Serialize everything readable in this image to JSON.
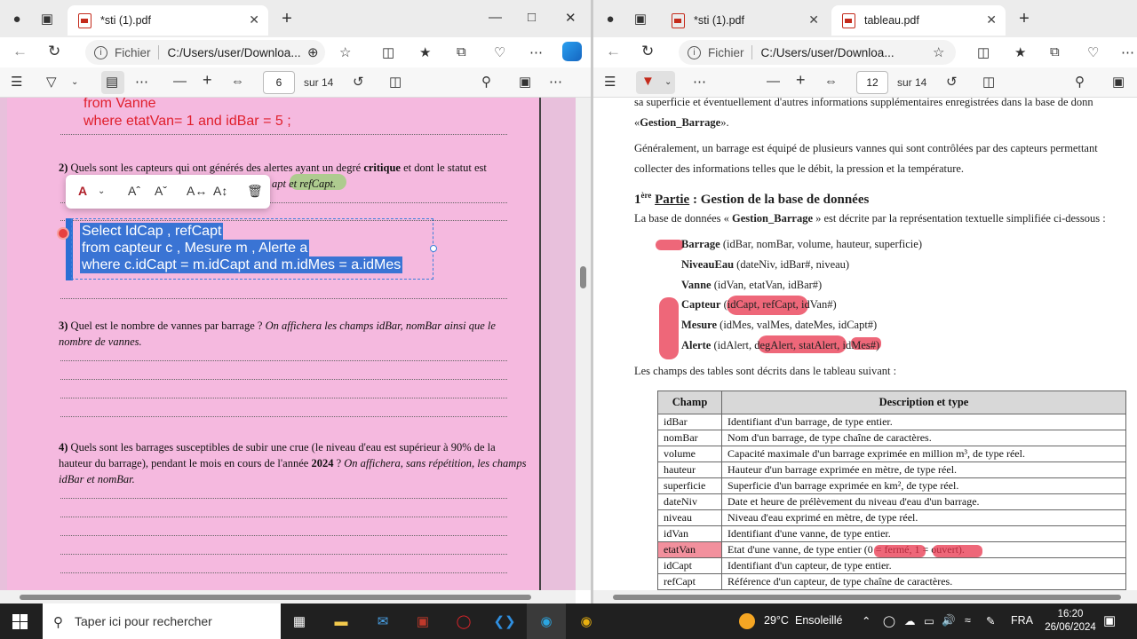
{
  "left_window": {
    "tab_title": "*sti (1).pdf",
    "url_label": "Fichier",
    "url": "C:/Users/user/Downloa...",
    "page_current": "6",
    "page_total": "sur 14",
    "document": {
      "sql_prev_line1": "from Vanne",
      "sql_prev_line2": "where etatVan= 1 and idBar = 5 ;",
      "q2_num": "2)",
      "q2_text": "Quels sont les capteurs qui ont générés des alertes ayant un degré",
      "q2_bold": "critique",
      "q2_text2": "et dont le statut est",
      "q2_partial": "apt et refCapt.",
      "sql_selected": [
        "Select IdCap , refCapt",
        "from capteur c , Mesure m , Alerte a",
        "where c.idCapt = m.idCapt and m.idMes = a.idMes"
      ],
      "q3_num": "3)",
      "q3_text": "Quel est le nombre de vannes par barrage ?",
      "q3_italic": "On affichera les champs idBar, nomBar ainsi que le nombre de vannes.",
      "q4_num": "4)",
      "q4_text1": "Quels sont les barrages susceptibles de subir une crue (le niveau d'eau est supérieur à 90% de la",
      "q4_text2": "hauteur du barrage), pendant le mois en cours de l'année",
      "q4_year": "2024",
      "q4_italic": "On affichera, sans répétition,",
      "q4_italic2": "les champs idBar et nomBar."
    }
  },
  "right_window": {
    "tab1_title": "*sti (1).pdf",
    "tab2_title": "tableau.pdf",
    "url_label": "Fichier",
    "url": "C:/Users/user/Downloa...",
    "page_current": "12",
    "page_total": "sur 14",
    "document": {
      "line_top": "sa superficie et éventuellement d'autres informations supplémentaires enregistrées dans la base de donn",
      "line_top2_pre": "«",
      "line_top2_bold": "Gestion_Barrage",
      "line_top2_post": "».",
      "para1": "Généralement, un barrage est équipé de plusieurs vannes qui sont contrôlées par des capteurs permettant",
      "para2": "collecter des informations telles que le débit, la pression et la température.",
      "section_sup": "ère",
      "section_num": "1",
      "section_partie": "Partie",
      "section_title": ": Gestion de la base de données",
      "intro_pre": "La base de données «",
      "intro_bold": "Gestion_Barrage",
      "intro_post": "» est décrite par la représentation textuelle simplifiée ci-dessous :",
      "schemas": [
        {
          "name": "Barrage",
          "rest": "(idBar, nomBar, volume, hauteur, superficie)"
        },
        {
          "name": "NiveauEau",
          "rest": "(dateNiv, idBar#, niveau)"
        },
        {
          "name": "Vanne",
          "rest": "(idVan, etatVan, idBar#)"
        },
        {
          "name": "Capteur",
          "rest": "(idCapt, refCapt, idVan#)"
        },
        {
          "name": "Mesure",
          "rest": "(idMes, valMes, dateMes, idCapt#)"
        },
        {
          "name": "Alerte",
          "rest": "(idAlert, degAlert, statAlert, idMes#)"
        }
      ],
      "table_intro": "Les champs des tables sont décrits dans le tableau suivant :",
      "table_header": [
        "Champ",
        "Description et type"
      ],
      "table_rows": [
        [
          "idBar",
          "Identifiant d'un barrage, de type entier."
        ],
        [
          "nomBar",
          "Nom d'un barrage, de type chaîne de caractères."
        ],
        [
          "volume",
          "Capacité maximale d'un barrage exprimée en million m³, de type réel."
        ],
        [
          "hauteur",
          "Hauteur d'un barrage exprimée en mètre, de type réel."
        ],
        [
          "superficie",
          "Superficie d'un barrage exprimée en km², de type réel."
        ],
        [
          "dateNiv",
          "Date et heure de prélèvement du niveau d'eau d'un barrage."
        ],
        [
          "niveau",
          "Niveau d'eau exprimé en mètre, de type réel."
        ],
        [
          "idVan",
          "Identifiant d'une vanne, de type entier."
        ],
        [
          "etatVan",
          "Etat d'une vanne, de type entier (0 = fermé, 1 = ouvert)."
        ],
        [
          "idCapt",
          "Identifiant d'un capteur, de type entier."
        ],
        [
          "refCapt",
          "Référence d'un capteur, de type chaîne de caractères."
        ]
      ]
    }
  },
  "taskbar": {
    "search_placeholder": "Taper ici pour rechercher",
    "weather_temp": "29°C",
    "weather_desc": "Ensoleillé",
    "language": "FRA",
    "time": "16:20",
    "date": "26/06/2024"
  },
  "colors": {
    "page_pink": "#f5b9df",
    "sql_red": "#e0202d",
    "selection_blue": "#3a74d4",
    "marker_red": "#e8344c",
    "taskbar": "#202020"
  }
}
